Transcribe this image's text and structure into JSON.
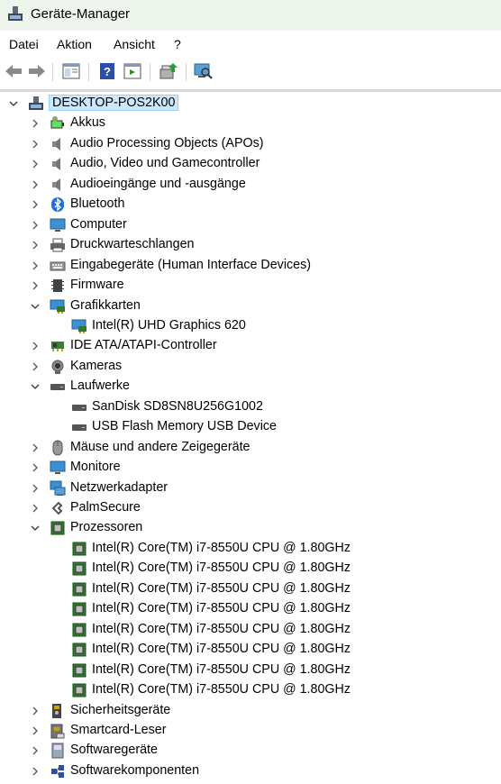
{
  "window": {
    "title": "Geräte-Manager"
  },
  "menu": [
    "Datei",
    "Aktion",
    "Ansicht",
    "?"
  ],
  "toolbar": [
    "back-arrow-icon",
    "forward-arrow-icon",
    "properties-icon",
    "help-icon",
    "details-icon",
    "update-driver-icon",
    "scan-hardware-icon"
  ],
  "tree": [
    {
      "label": "DESKTOP-POS2K00",
      "level": 0,
      "state": "expanded",
      "icon": "computer-icon",
      "selected": true
    },
    {
      "label": "Akkus",
      "level": 1,
      "state": "collapsed",
      "icon": "battery-icon"
    },
    {
      "label": "Audio Processing Objects (APOs)",
      "level": 1,
      "state": "collapsed",
      "icon": "speaker-icon"
    },
    {
      "label": "Audio, Video und Gamecontroller",
      "level": 1,
      "state": "collapsed",
      "icon": "speaker-icon"
    },
    {
      "label": "Audioeingänge und -ausgänge",
      "level": 1,
      "state": "collapsed",
      "icon": "speaker-icon"
    },
    {
      "label": "Bluetooth",
      "level": 1,
      "state": "collapsed",
      "icon": "bluetooth-icon"
    },
    {
      "label": "Computer",
      "level": 1,
      "state": "collapsed",
      "icon": "monitor-icon"
    },
    {
      "label": "Druckwarteschlangen",
      "level": 1,
      "state": "collapsed",
      "icon": "printer-icon"
    },
    {
      "label": "Eingabegeräte (Human Interface Devices)",
      "level": 1,
      "state": "collapsed",
      "icon": "keyboard-icon"
    },
    {
      "label": "Firmware",
      "level": 1,
      "state": "collapsed",
      "icon": "chip-icon"
    },
    {
      "label": "Grafikkarten",
      "level": 1,
      "state": "expanded",
      "icon": "display-adapter-icon"
    },
    {
      "label": "Intel(R) UHD Graphics 620",
      "level": 2,
      "state": "leaf",
      "icon": "display-adapter-icon"
    },
    {
      "label": "IDE ATA/ATAPI-Controller",
      "level": 1,
      "state": "collapsed",
      "icon": "controller-icon"
    },
    {
      "label": "Kameras",
      "level": 1,
      "state": "collapsed",
      "icon": "camera-icon"
    },
    {
      "label": "Laufwerke",
      "level": 1,
      "state": "expanded",
      "icon": "drive-icon"
    },
    {
      "label": "SanDisk SD8SN8U256G1002",
      "level": 2,
      "state": "leaf",
      "icon": "drive-icon"
    },
    {
      "label": "USB Flash Memory USB Device",
      "level": 2,
      "state": "leaf",
      "icon": "drive-icon"
    },
    {
      "label": "Mäuse und andere Zeigegeräte",
      "level": 1,
      "state": "collapsed",
      "icon": "mouse-icon"
    },
    {
      "label": "Monitore",
      "level": 1,
      "state": "collapsed",
      "icon": "monitor-icon"
    },
    {
      "label": "Netzwerkadapter",
      "level": 1,
      "state": "collapsed",
      "icon": "network-icon"
    },
    {
      "label": "PalmSecure",
      "level": 1,
      "state": "collapsed",
      "icon": "palm-sensor-icon"
    },
    {
      "label": "Prozessoren",
      "level": 1,
      "state": "expanded",
      "icon": "cpu-icon"
    },
    {
      "label": "Intel(R) Core(TM) i7-8550U CPU @ 1.80GHz",
      "level": 2,
      "state": "leaf",
      "icon": "cpu-icon"
    },
    {
      "label": "Intel(R) Core(TM) i7-8550U CPU @ 1.80GHz",
      "level": 2,
      "state": "leaf",
      "icon": "cpu-icon"
    },
    {
      "label": "Intel(R) Core(TM) i7-8550U CPU @ 1.80GHz",
      "level": 2,
      "state": "leaf",
      "icon": "cpu-icon"
    },
    {
      "label": "Intel(R) Core(TM) i7-8550U CPU @ 1.80GHz",
      "level": 2,
      "state": "leaf",
      "icon": "cpu-icon"
    },
    {
      "label": "Intel(R) Core(TM) i7-8550U CPU @ 1.80GHz",
      "level": 2,
      "state": "leaf",
      "icon": "cpu-icon"
    },
    {
      "label": "Intel(R) Core(TM) i7-8550U CPU @ 1.80GHz",
      "level": 2,
      "state": "leaf",
      "icon": "cpu-icon"
    },
    {
      "label": "Intel(R) Core(TM) i7-8550U CPU @ 1.80GHz",
      "level": 2,
      "state": "leaf",
      "icon": "cpu-icon"
    },
    {
      "label": "Intel(R) Core(TM) i7-8550U CPU @ 1.80GHz",
      "level": 2,
      "state": "leaf",
      "icon": "cpu-icon"
    },
    {
      "label": "Sicherheitsgeräte",
      "level": 1,
      "state": "collapsed",
      "icon": "security-icon"
    },
    {
      "label": "Smartcard-Leser",
      "level": 1,
      "state": "collapsed",
      "icon": "smartcard-icon"
    },
    {
      "label": "Softwaregeräte",
      "level": 1,
      "state": "collapsed",
      "icon": "software-device-icon"
    },
    {
      "label": "Softwarekomponenten",
      "level": 1,
      "state": "collapsed",
      "icon": "component-icon"
    }
  ]
}
